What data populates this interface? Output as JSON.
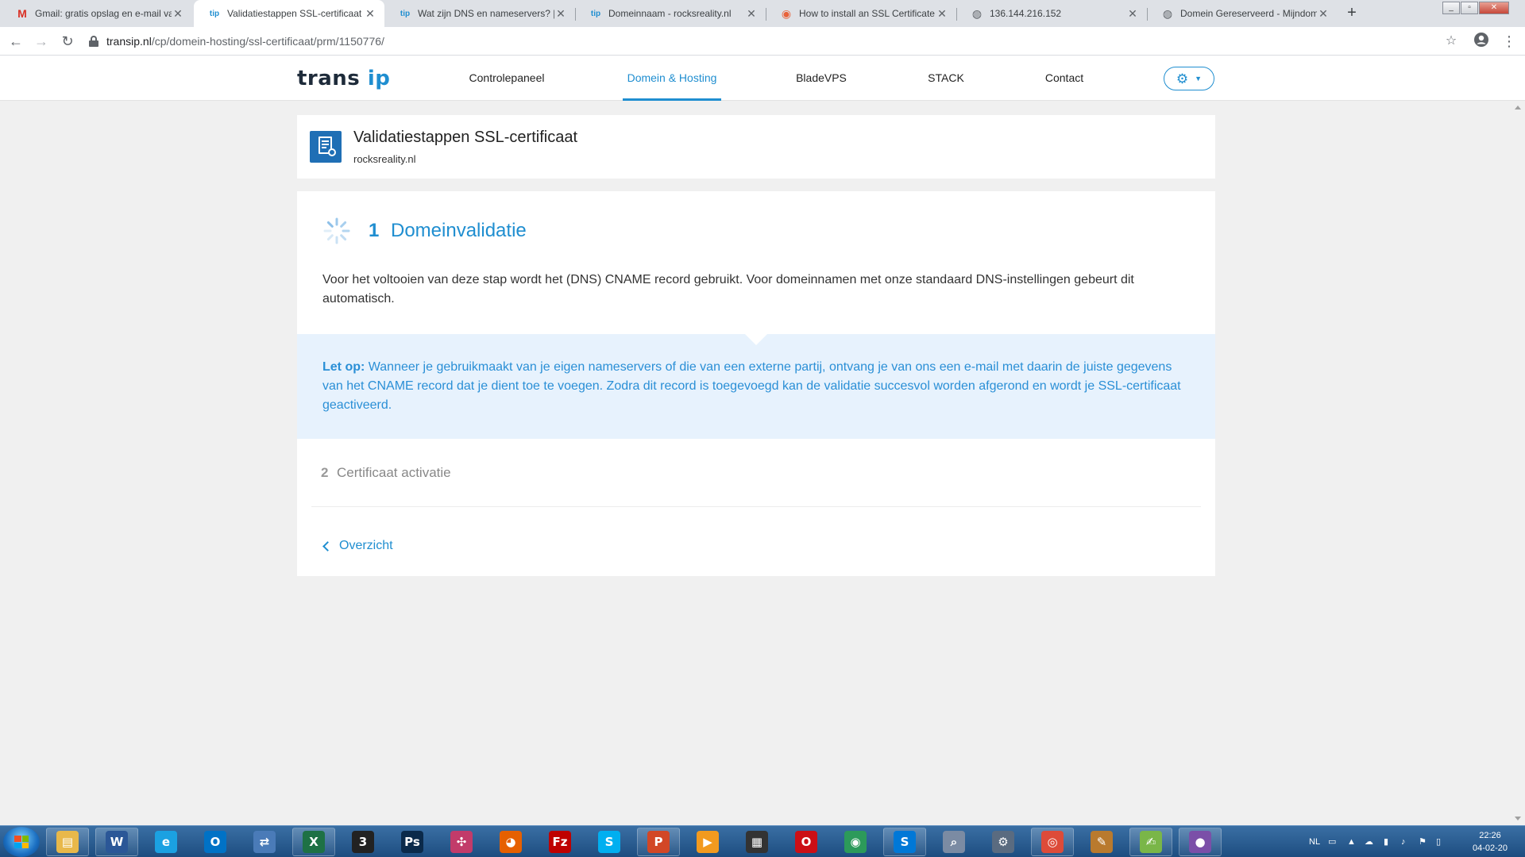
{
  "browser": {
    "tabs": [
      {
        "title": "Gmail: gratis opslag en e-mail va",
        "icon": "gmail-icon",
        "favicon_text": "M",
        "favicon_color": "#d93025",
        "active": false
      },
      {
        "title": "Validatiestappen SSL-certificaat",
        "icon": "transip-icon",
        "favicon_text": "tip",
        "favicon_color": "#1f8ed0",
        "active": true
      },
      {
        "title": "Wat zijn DNS en nameservers? | T",
        "icon": "transip-icon",
        "favicon_text": "tip",
        "favicon_color": "#1f8ed0",
        "active": false
      },
      {
        "title": "Domeinnaam - rocksreality.nl",
        "icon": "transip-icon",
        "favicon_text": "tip",
        "favicon_color": "#1f8ed0",
        "active": false
      },
      {
        "title": "How to install an SSL Certificate c",
        "icon": "site-icon",
        "favicon_text": "◉",
        "favicon_color": "#e8623a",
        "active": false
      },
      {
        "title": "136.144.216.152",
        "icon": "globe-icon",
        "favicon_text": "◍",
        "favicon_color": "#5f6368",
        "active": false
      },
      {
        "title": "Domein Gereserveerd - Mijndom",
        "icon": "globe-icon",
        "favicon_text": "◍",
        "favicon_color": "#5f6368",
        "active": false
      }
    ],
    "url": {
      "host": "transip.nl",
      "path": "/cp/domein-hosting/ssl-certificaat/prm/1150776/"
    }
  },
  "site": {
    "logo": {
      "part1": "trans",
      "part2": "ip"
    },
    "nav": [
      {
        "label": "Controlepaneel",
        "active": false
      },
      {
        "label": "Domein & Hosting",
        "active": true
      },
      {
        "label": "BladeVPS",
        "active": false
      },
      {
        "label": "STACK",
        "active": false
      },
      {
        "label": "Contact",
        "active": false
      }
    ]
  },
  "page": {
    "title": "Validatiestappen SSL-certificaat",
    "subtitle": "rocksreality.nl",
    "step1": {
      "number": "1",
      "title": "Domeinvalidatie",
      "text": "Voor het voltooien van deze stap wordt het (DNS) CNAME record gebruikt. Voor domeinnamen met onze standaard DNS-instellingen gebeurt dit automatisch."
    },
    "notice": {
      "label": "Let op:",
      "text": " Wanneer je gebruikmaakt van je eigen nameservers of die van een externe partij, ontvang je van ons een e-mail met daarin de juiste gegevens van het CNAME record dat je dient toe te voegen. Zodra dit record is toegevoegd kan de validatie succesvol worden afgerond en wordt je SSL-certificaat geactiveerd."
    },
    "step2": {
      "number": "2",
      "title": "Certificaat activatie"
    },
    "back_link": "Overzicht"
  },
  "colors": {
    "accent": "#1f8ed0",
    "notice_bg": "#e7f2fd",
    "notice_text": "#2a8fd6"
  },
  "taskbar": {
    "apps": [
      {
        "name": "explorer",
        "icon": "folder-icon",
        "glyph": "▤",
        "color": "#e8b84a",
        "open": true
      },
      {
        "name": "word",
        "icon": "word-icon",
        "glyph": "W",
        "color": "#2b5797",
        "open": true
      },
      {
        "name": "internet-explorer",
        "icon": "ie-icon",
        "glyph": "e",
        "color": "#1ba1e2",
        "open": false
      },
      {
        "name": "outlook",
        "icon": "outlook-icon",
        "glyph": "O",
        "color": "#0072c6",
        "open": false
      },
      {
        "name": "network",
        "icon": "network-icon",
        "glyph": "⇄",
        "color": "#4a7bb8",
        "open": false
      },
      {
        "name": "excel",
        "icon": "excel-icon",
        "glyph": "X",
        "color": "#1e7145",
        "open": true
      },
      {
        "name": "app-3",
        "icon": "app3-icon",
        "glyph": "3",
        "color": "#222222",
        "open": false
      },
      {
        "name": "photoshop",
        "icon": "photoshop-icon",
        "glyph": "Ps",
        "color": "#0b2a4a",
        "open": false
      },
      {
        "name": "app-tool",
        "icon": "tool-icon",
        "glyph": "✣",
        "color": "#c23b6a",
        "open": false
      },
      {
        "name": "firefox",
        "icon": "firefox-icon",
        "glyph": "◕",
        "color": "#e66000",
        "open": false
      },
      {
        "name": "filezilla",
        "icon": "filezilla-icon",
        "glyph": "Fz",
        "color": "#bf0000",
        "open": false
      },
      {
        "name": "skype",
        "icon": "skype-icon",
        "glyph": "S",
        "color": "#00aff0",
        "open": false
      },
      {
        "name": "powerpoint",
        "icon": "powerpoint-icon",
        "glyph": "P",
        "color": "#d24726",
        "open": true
      },
      {
        "name": "media-player",
        "icon": "media-player-icon",
        "glyph": "▶",
        "color": "#f29a1f",
        "open": false
      },
      {
        "name": "video-editor",
        "icon": "clapper-icon",
        "glyph": "▦",
        "color": "#333333",
        "open": false
      },
      {
        "name": "opera",
        "icon": "opera-icon",
        "glyph": "O",
        "color": "#cc0f16",
        "open": false
      },
      {
        "name": "globe-app",
        "icon": "globe-app-icon",
        "glyph": "◉",
        "color": "#2c9a5a",
        "open": false
      },
      {
        "name": "skype-business",
        "icon": "skype-business-icon",
        "glyph": "S",
        "color": "#0078d7",
        "open": true
      },
      {
        "name": "sniffer",
        "icon": "magnifier-icon",
        "glyph": "⌕",
        "color": "#7b8ba3",
        "open": false
      },
      {
        "name": "settings",
        "icon": "gear-app-icon",
        "glyph": "⚙",
        "color": "#5a6b80",
        "open": false
      },
      {
        "name": "chrome",
        "icon": "chrome-icon",
        "glyph": "◎",
        "color": "#dd4b39",
        "open": true
      },
      {
        "name": "app-pen",
        "icon": "pen-icon",
        "glyph": "✎",
        "color": "#b97a2e",
        "open": false
      },
      {
        "name": "notepad",
        "icon": "notepad-icon",
        "glyph": "✍",
        "color": "#7ab648",
        "open": true
      },
      {
        "name": "app-cat",
        "icon": "cat-icon",
        "glyph": "●",
        "color": "#7b4fa8",
        "open": true
      }
    ],
    "tray": {
      "lang": "NL",
      "time": "22:26",
      "date": "04-02-20"
    }
  }
}
